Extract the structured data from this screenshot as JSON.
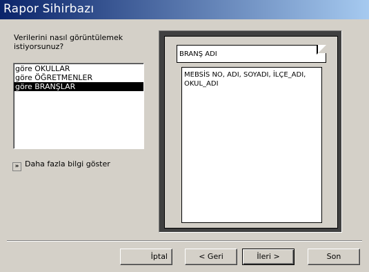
{
  "window": {
    "title": "Rapor Sihirbazı"
  },
  "prompt": {
    "text": "Verilerini nasıl görüntülemek istiyorsunuz?"
  },
  "view_list": {
    "items": [
      {
        "label": "göre OKULLAR",
        "selected": false
      },
      {
        "label": "göre ÖĞRETMENLER",
        "selected": false
      },
      {
        "label": "göre BRANŞLAR",
        "selected": true
      }
    ]
  },
  "more_info": {
    "icon": "expand-arrows-icon",
    "label": "Daha fazla bilgi göster"
  },
  "preview": {
    "header": "BRANŞ ADI",
    "detail": "MEBSİS NO, ADI, SOYADI, İLÇE_ADI, OKUL_ADI"
  },
  "buttons": {
    "cancel": "İptal",
    "back": "< Geri",
    "next": "İleri >",
    "finish": "Son"
  }
}
